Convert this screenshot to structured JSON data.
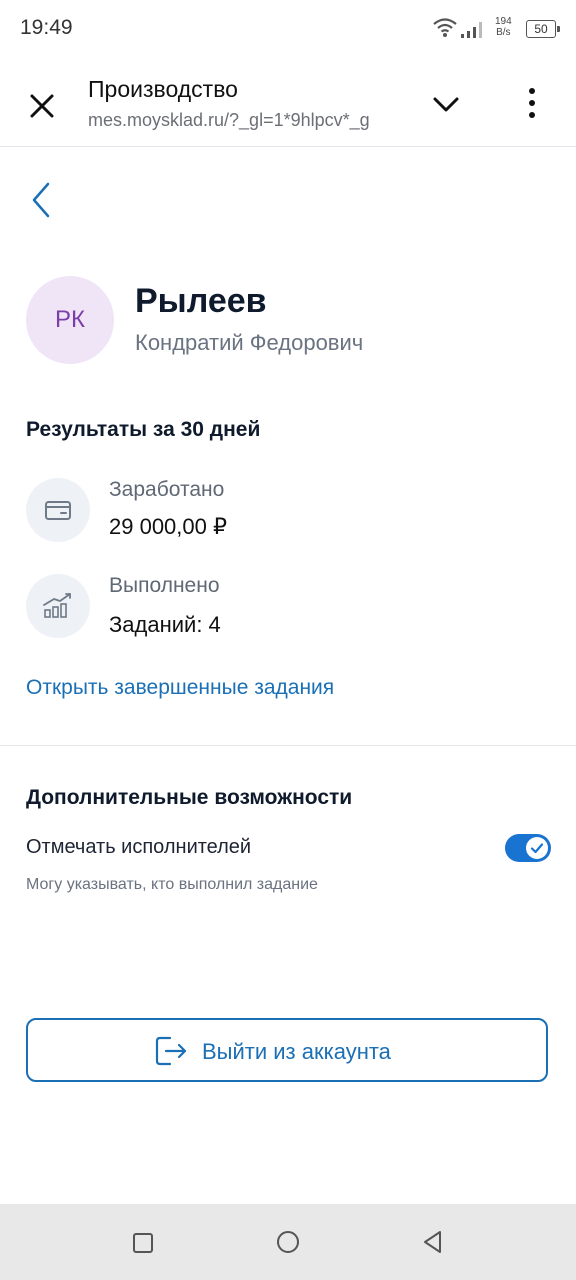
{
  "status_bar": {
    "time": "19:49",
    "net_speed_value": "194",
    "net_speed_unit": "B/s",
    "battery": "50"
  },
  "browser": {
    "title": "Производство",
    "url": "mes.moysklad.ru/?_gl=1*9hlpcv*_g",
    "icons": [
      "close-icon",
      "chevron-down-icon",
      "more-vertical-icon"
    ]
  },
  "profile": {
    "initials": "РК",
    "last_name": "Рылеев",
    "first_name": "Кондратий Федорович"
  },
  "results": {
    "heading": "Результаты за 30 дней",
    "earned_label": "Заработано",
    "earned_value": "29 000,00 ₽",
    "done_label": "Выполнено",
    "done_value": "Заданий: 4",
    "open_link": "Открыть завершенные задания"
  },
  "extra": {
    "heading": "Дополнительные возможности",
    "mark_label": "Отмечать исполнителей",
    "mark_enabled": true,
    "mark_desc": "Могу указывать, кто выполнил задание"
  },
  "logout": {
    "label": "Выйти из аккаунта"
  },
  "colors": {
    "accent": "#1b6fb5",
    "toggle_on": "#1973d1",
    "avatar_bg": "#f0e4f7",
    "avatar_text": "#7b3fa7"
  }
}
